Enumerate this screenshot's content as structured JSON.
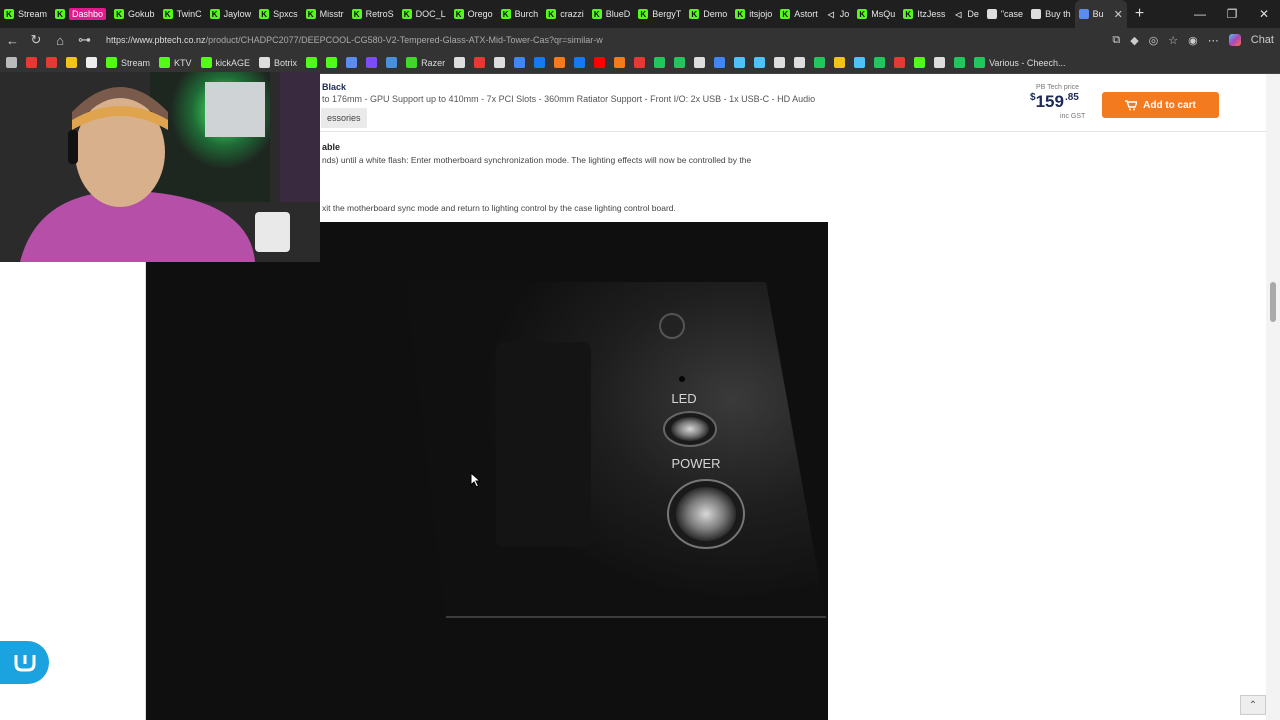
{
  "browser": {
    "tabs": [
      {
        "label": "Stream",
        "icon": "kick-icon"
      },
      {
        "label": "Dashbo",
        "icon": "kick-icon",
        "highlight": true
      },
      {
        "label": "Gokub",
        "icon": "kick-icon"
      },
      {
        "label": "TwinC",
        "icon": "kick-icon"
      },
      {
        "label": "Jaylow",
        "icon": "kick-icon"
      },
      {
        "label": "Spxcs",
        "icon": "kick-icon"
      },
      {
        "label": "Misstr",
        "icon": "kick-icon"
      },
      {
        "label": "RetroS",
        "icon": "kick-icon"
      },
      {
        "label": "DOC_L",
        "icon": "kick-icon"
      },
      {
        "label": "Orego",
        "icon": "kick-icon"
      },
      {
        "label": "Burch",
        "icon": "kick-icon"
      },
      {
        "label": "crazzi",
        "icon": "kick-icon"
      },
      {
        "label": "BlueD",
        "icon": "kick-icon"
      },
      {
        "label": "BergyT",
        "icon": "kick-icon"
      },
      {
        "label": "Demo",
        "icon": "kick-icon"
      },
      {
        "label": "itsjojo",
        "icon": "kick-icon"
      },
      {
        "label": "Astort",
        "icon": "kick-icon"
      },
      {
        "label": "Jo",
        "icon": "speaker-icon"
      },
      {
        "label": "MsQu",
        "icon": "kick-icon"
      },
      {
        "label": "ItzJess",
        "icon": "kick-icon"
      },
      {
        "label": "De",
        "icon": "speaker-icon"
      },
      {
        "label": "\"case",
        "icon": "page-icon"
      },
      {
        "label": "Buy th",
        "icon": "page-icon"
      },
      {
        "label": "Bu",
        "icon": "pbtech-icon",
        "active": true
      }
    ],
    "url_host": "https://www.pbtech.co.nz",
    "url_path": "/product/CHADPC2077/DEEPCOOL-CG580-V2-Tempered-Glass-ATX-Mid-Tower-Cas?qr=similar-w",
    "chat_label": "Chat",
    "bookmarks": [
      {
        "label": "",
        "color": "#bbbbbb"
      },
      {
        "label": "",
        "color": "#e53935"
      },
      {
        "label": "",
        "color": "#e53935"
      },
      {
        "label": "",
        "color": "#f0c419"
      },
      {
        "label": "",
        "color": "#eeeeee"
      },
      {
        "label": "Stream",
        "color": "#53fc18"
      },
      {
        "label": "KTV",
        "color": "#53fc18"
      },
      {
        "label": "kickAGE",
        "color": "#53fc18"
      },
      {
        "label": "Botrix",
        "color": "#dddddd"
      },
      {
        "label": "",
        "color": "#53fc18"
      },
      {
        "label": "",
        "color": "#53fc18"
      },
      {
        "label": "",
        "color": "#5b8def"
      },
      {
        "label": "",
        "color": "#7b4dff"
      },
      {
        "label": "",
        "color": "#4a90d9"
      },
      {
        "label": "Razer",
        "color": "#44d62c"
      },
      {
        "label": "",
        "color": "#dddddd"
      },
      {
        "label": "",
        "color": "#e53935"
      },
      {
        "label": "",
        "color": "#dddddd"
      },
      {
        "label": "",
        "color": "#4285f4"
      },
      {
        "label": "",
        "color": "#1877f2"
      },
      {
        "label": "",
        "color": "#f47a20"
      },
      {
        "label": "",
        "color": "#1877f2"
      },
      {
        "label": "",
        "color": "#ff0000"
      },
      {
        "label": "",
        "color": "#f47a20"
      },
      {
        "label": "",
        "color": "#e53935"
      },
      {
        "label": "",
        "color": "#22c55e"
      },
      {
        "label": "",
        "color": "#22c55e"
      },
      {
        "label": "",
        "color": "#dddddd"
      },
      {
        "label": "",
        "color": "#4285f4"
      },
      {
        "label": "",
        "color": "#4fc3f7"
      },
      {
        "label": "",
        "color": "#4fc3f7"
      },
      {
        "label": "",
        "color": "#dddddd"
      },
      {
        "label": "",
        "color": "#dddddd"
      },
      {
        "label": "",
        "color": "#22c55e"
      },
      {
        "label": "",
        "color": "#f0c419"
      },
      {
        "label": "",
        "color": "#4fc3f7"
      },
      {
        "label": "",
        "color": "#22c55e"
      },
      {
        "label": "",
        "color": "#e53935"
      },
      {
        "label": "",
        "color": "#53fc18"
      },
      {
        "label": "",
        "color": "#dddddd"
      },
      {
        "label": "",
        "color": "#22c55e"
      },
      {
        "label": "Various - Cheech...",
        "color": "#22c55e"
      }
    ]
  },
  "product": {
    "title": "Black",
    "specs": "to 176mm - GPU Support up to 410mm - 7x PCI Slots - 360mm Ratiator Support - Front I/O: 2x USB - 1x USB-C - HD Audio",
    "accessories_tab": "essories",
    "price_label": "PB Tech price",
    "price_currency": "$",
    "price_dollars": "159",
    "price_cents": ".85",
    "price_gst": "inc GST",
    "add_to_cart": "Add to cart"
  },
  "description": {
    "heading": "able",
    "line1": "nds) until a white flash: Enter motherboard synchronization mode. The lighting effects will now be controlled by the",
    "line2": "xit the motherboard sync mode and return to lighting control by the case lighting control board."
  },
  "photo": {
    "led_label": "LED",
    "power_label": "POWER"
  },
  "colors": {
    "accent_orange": "#f47a20",
    "brand_navy": "#1c2a55",
    "kick_green": "#53fc18",
    "chat_blue": "#1ba3e0"
  }
}
